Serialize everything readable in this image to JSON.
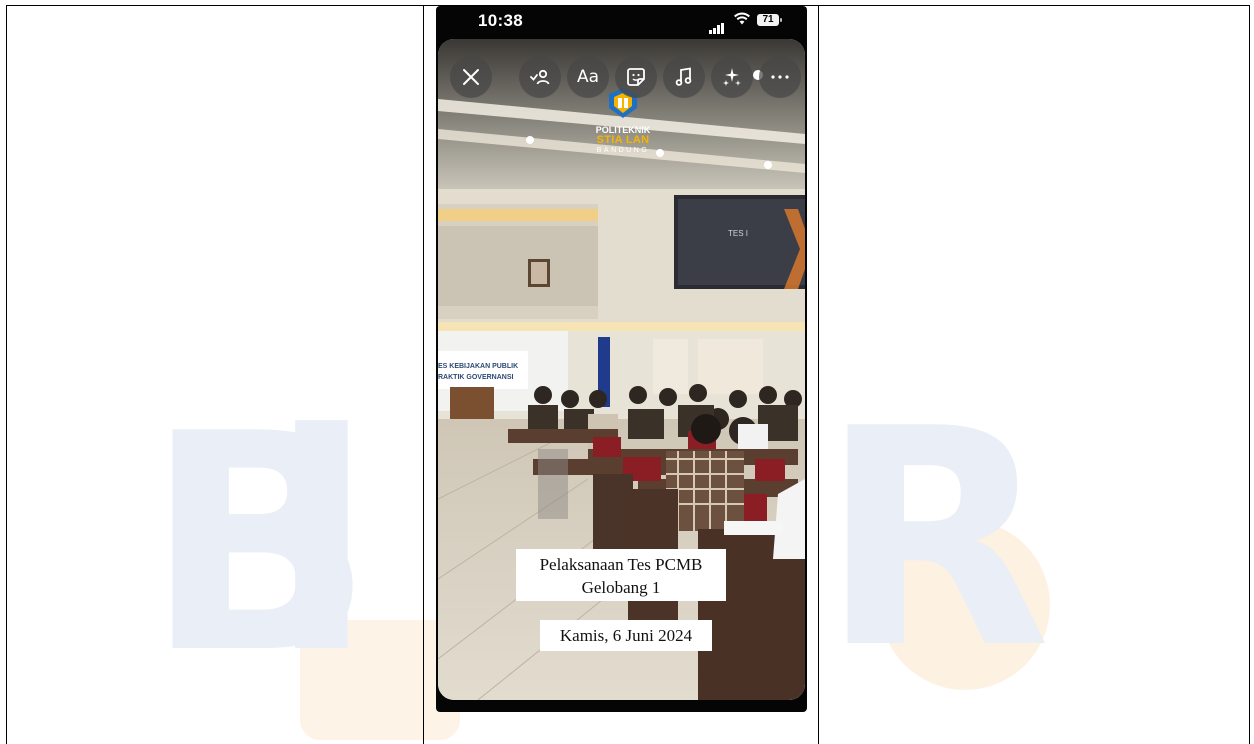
{
  "status_bar": {
    "time": "10:38",
    "battery": "71"
  },
  "story": {
    "toolbar": {
      "text_label": "Aa"
    },
    "logo": {
      "line1": "POLITEKNIK",
      "line2": "STIA LAN",
      "line3": "BANDUNG"
    },
    "scene_texts": {
      "banner_line1": "ES KEBIJAKAN PUBLIK",
      "banner_line2": "RAKTIK GOVERNANSI",
      "screen_text": "TES I"
    },
    "caption": {
      "line1": "Pelaksanaan Tes PCMB",
      "line2": "Gelobang 1",
      "date": "Kamis, 6 Juni 2024"
    }
  },
  "watermark": {
    "text": "BLOGGER"
  },
  "colors": {
    "accent_gold": "#f6b400",
    "logo_blue": "#1f6fc2",
    "toolbar_bg": "#464646",
    "watermark_blue": "#e9eef7"
  }
}
